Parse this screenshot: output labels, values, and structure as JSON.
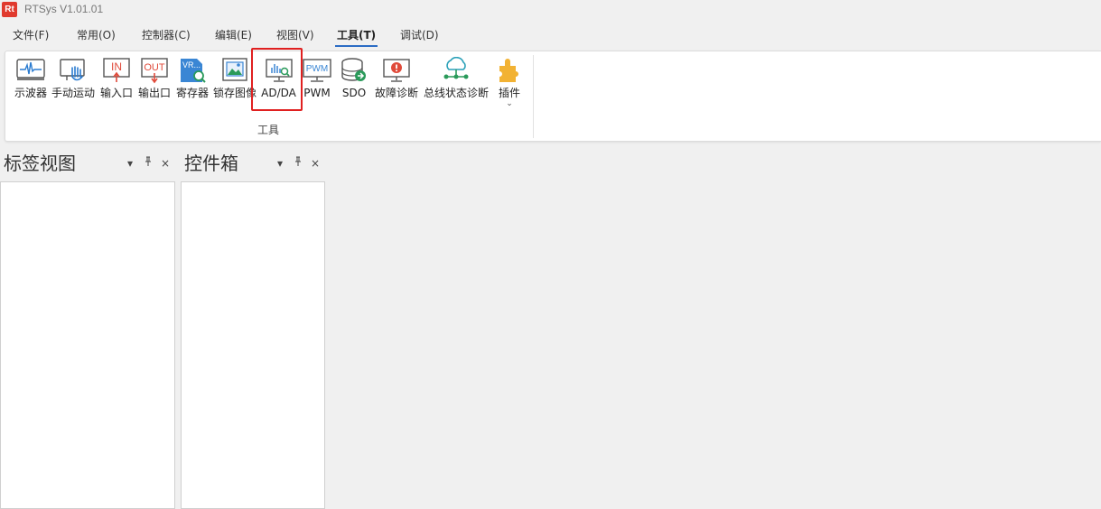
{
  "app": {
    "logo_text": "Rt",
    "title": "RTSys V1.01.01"
  },
  "menu": [
    {
      "label": "文件(F)"
    },
    {
      "label": "常用(O)"
    },
    {
      "label": "控制器(C)"
    },
    {
      "label": "编辑(E)"
    },
    {
      "label": "视图(V)"
    },
    {
      "label": "工具(T)",
      "active": true
    },
    {
      "label": "调试(D)"
    }
  ],
  "ribbon": {
    "group_label": "工具",
    "tools": [
      {
        "label": "示波器",
        "icon": "oscilloscope-icon"
      },
      {
        "label": "手动运动",
        "icon": "hand-motion-icon"
      },
      {
        "label": "输入口",
        "icon": "input-port-icon",
        "icon_text": "IN"
      },
      {
        "label": "输出口",
        "icon": "output-port-icon",
        "icon_text": "OUT"
      },
      {
        "label": "寄存器",
        "icon": "register-icon",
        "icon_text": "VR..."
      },
      {
        "label": "锁存图像",
        "icon": "latch-image-icon"
      },
      {
        "label": "AD/DA",
        "icon": "ad-da-icon",
        "highlighted": true
      },
      {
        "label": "PWM",
        "icon": "pwm-icon",
        "icon_text": "PWM"
      },
      {
        "label": "SDO",
        "icon": "sdo-icon"
      },
      {
        "label": "故障诊断",
        "icon": "fault-diagnosis-icon"
      },
      {
        "label": "总线状态诊断",
        "icon": "bus-status-icon"
      },
      {
        "label": "插件",
        "icon": "plugin-icon",
        "has_dropdown": true
      }
    ]
  },
  "panels": [
    {
      "title": "标签视图"
    },
    {
      "title": "控件箱"
    }
  ],
  "panel_controls": {
    "dropdown": "▾",
    "pin": "ꟸ",
    "close": "×"
  },
  "colors": {
    "accent": "#2b6cc4",
    "highlight": "#e02020",
    "logo": "#e03a2e"
  }
}
